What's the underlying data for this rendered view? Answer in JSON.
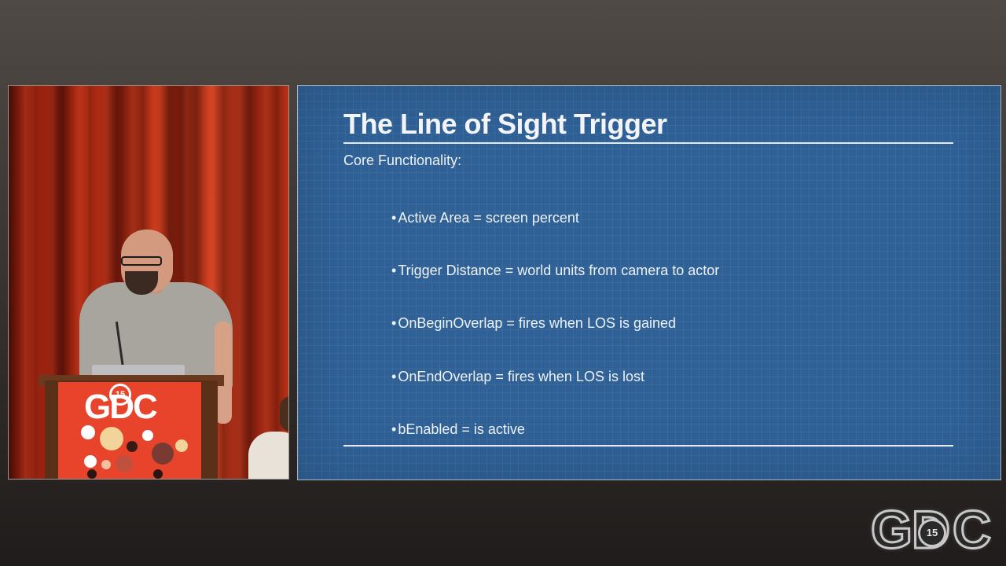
{
  "video": {
    "podium_logo_text": "GDC",
    "podium_logo_number": "15"
  },
  "slide": {
    "title": "The Line of Sight Trigger",
    "subtitle": "Core Functionality:",
    "bullet_mark": "•",
    "bullets": [
      "Active Area = screen percent",
      "Trigger Distance = world units from camera to actor",
      "OnBeginOverlap = fires when LOS is gained",
      "OnEndOverlap = fires when LOS is lost",
      "bEnabled = is active"
    ]
  },
  "corner_logo": {
    "letters": [
      "G",
      "D",
      "C"
    ],
    "number": "15"
  },
  "colors": {
    "slide_background": "#2f6197",
    "slide_text": "#eef2f6",
    "podium_sign": "#e8442c"
  }
}
